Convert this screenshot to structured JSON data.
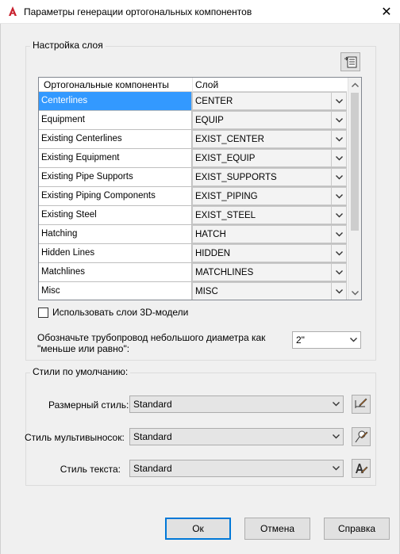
{
  "window": {
    "title": "Параметры генерации ортогональных компонентов",
    "close_glyph": "✕"
  },
  "layer_settings": {
    "legend": "Настройка слоя",
    "columns": [
      "Ортогональные компоненты",
      "Слой"
    ],
    "rows": [
      {
        "component": "Centerlines",
        "layer": "CENTER"
      },
      {
        "component": "Equipment",
        "layer": "EQUIP"
      },
      {
        "component": "Existing Centerlines",
        "layer": "EXIST_CENTER"
      },
      {
        "component": "Existing Equipment",
        "layer": "EXIST_EQUIP"
      },
      {
        "component": "Existing Pipe Supports",
        "layer": "EXIST_SUPPORTS"
      },
      {
        "component": "Existing Piping Components",
        "layer": "EXIST_PIPING"
      },
      {
        "component": "Existing Steel",
        "layer": "EXIST_STEEL"
      },
      {
        "component": "Hatching",
        "layer": "HATCH"
      },
      {
        "component": "Hidden Lines",
        "layer": "HIDDEN"
      },
      {
        "component": "Matchlines",
        "layer": "MATCHLINES"
      },
      {
        "component": "Misc",
        "layer": "MISC"
      }
    ],
    "selected_row": 0,
    "use_3d_layers_label": "Использовать слои 3D-модели",
    "use_3d_layers_checked": false,
    "small_pipe_label_line1": "Обозначьте трубопровод небольшого диаметра как",
    "small_pipe_label_line2": "\"меньше или равно\":",
    "small_pipe_value": "2\""
  },
  "default_styles": {
    "legend": "Стили по умолчанию:",
    "dim_style_label": "Размерный стиль:",
    "dim_style_value": "Standard",
    "mleader_style_label": "Стиль мультивыносок:",
    "mleader_style_value": "Standard",
    "text_style_label": "Стиль текста:",
    "text_style_value": "Standard"
  },
  "buttons": {
    "ok": "Ок",
    "cancel": "Отмена",
    "help": "Справка"
  },
  "colors": {
    "selection": "#3399ff",
    "autocad_red": "#c8202d",
    "default_button_border": "#0078d7"
  }
}
